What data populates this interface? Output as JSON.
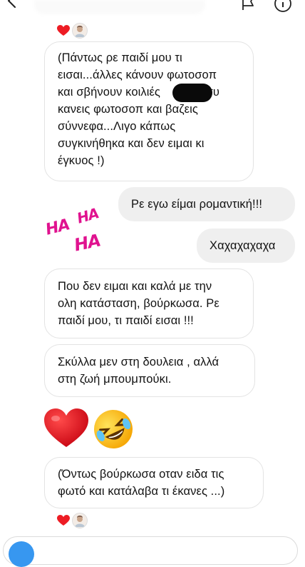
{
  "messages": [
    {
      "side": "in",
      "text": "(Πάντως ρε παιδί μου τι εισαι...άλλες κάνουν φωτοσοπ και σβήνουν κοιλιές          , εσυ κανεις φωτοσοπ και βαζεις σύννεφα...Λιγο κάπως συγκινήθηκα και δεν ειμαι κι έγκυος !)",
      "lines": [
        "(Πάντως ρε παιδί μου τι",
        "εισαι...άλλες κάνουν φωτοσοπ",
        "και σβήνουν κοιλιές          , εσυ",
        "κανεις φωτοσοπ και βαζεις",
        "σύννεφα...Λιγο κάπως",
        "συγκινήθηκα και δεν ειμαι κι",
        "έγκυος !)"
      ]
    },
    {
      "side": "out",
      "text": "Ρε εγω είμαι ρομαντική!!!"
    },
    {
      "side": "out",
      "text": "Χαχαχαχαχα"
    },
    {
      "side": "in",
      "lines": [
        "Που δεν ειμαι και καλά με την",
        "ολη κατάσταση, βούρκωσα. Ρε",
        "παιδί μου, τι παιδί εισαι !!!"
      ]
    },
    {
      "side": "in",
      "lines": [
        "Σκύλλα μεν στη δουλεια , αλλά",
        "στη ζωή μπουμπούκι."
      ]
    },
    {
      "side": "in",
      "lines": [
        "(Όντως βούρκωσα οταν ειδα τις",
        "φωτό και κατάλαβα τι έκανες ...)"
      ]
    }
  ],
  "sticker": {
    "words": [
      "HA",
      "HA",
      "HA"
    ],
    "color": "#e0128f"
  },
  "emoji_message": [
    "red-heart",
    "rolling-on-the-floor-laughing"
  ],
  "colors": {
    "outgoing_bubble": "#efefef",
    "incoming_border": "#e3e3e3",
    "heart": "#ed1c24",
    "accent": "#3797f0"
  }
}
